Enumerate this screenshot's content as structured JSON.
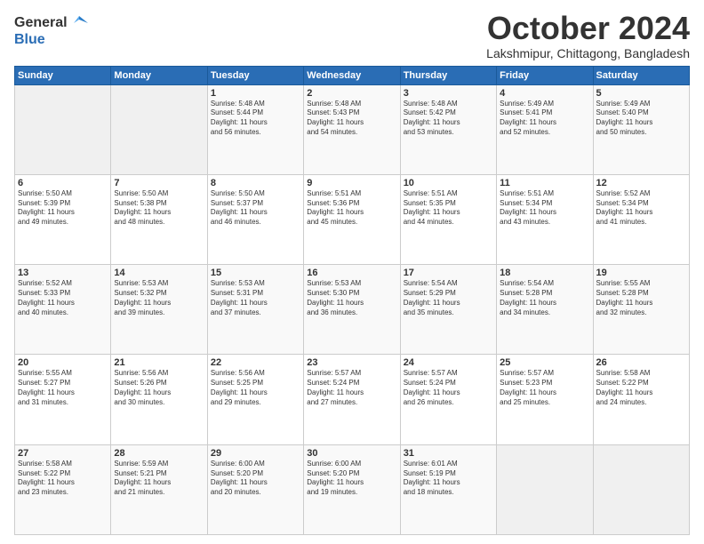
{
  "header": {
    "logo_line1": "General",
    "logo_line2": "Blue",
    "month": "October 2024",
    "location": "Lakshmipur, Chittagong, Bangladesh"
  },
  "weekdays": [
    "Sunday",
    "Monday",
    "Tuesday",
    "Wednesday",
    "Thursday",
    "Friday",
    "Saturday"
  ],
  "weeks": [
    [
      {
        "day": "",
        "info": ""
      },
      {
        "day": "",
        "info": ""
      },
      {
        "day": "1",
        "info": "Sunrise: 5:48 AM\nSunset: 5:44 PM\nDaylight: 11 hours\nand 56 minutes."
      },
      {
        "day": "2",
        "info": "Sunrise: 5:48 AM\nSunset: 5:43 PM\nDaylight: 11 hours\nand 54 minutes."
      },
      {
        "day": "3",
        "info": "Sunrise: 5:48 AM\nSunset: 5:42 PM\nDaylight: 11 hours\nand 53 minutes."
      },
      {
        "day": "4",
        "info": "Sunrise: 5:49 AM\nSunset: 5:41 PM\nDaylight: 11 hours\nand 52 minutes."
      },
      {
        "day": "5",
        "info": "Sunrise: 5:49 AM\nSunset: 5:40 PM\nDaylight: 11 hours\nand 50 minutes."
      }
    ],
    [
      {
        "day": "6",
        "info": "Sunrise: 5:50 AM\nSunset: 5:39 PM\nDaylight: 11 hours\nand 49 minutes."
      },
      {
        "day": "7",
        "info": "Sunrise: 5:50 AM\nSunset: 5:38 PM\nDaylight: 11 hours\nand 48 minutes."
      },
      {
        "day": "8",
        "info": "Sunrise: 5:50 AM\nSunset: 5:37 PM\nDaylight: 11 hours\nand 46 minutes."
      },
      {
        "day": "9",
        "info": "Sunrise: 5:51 AM\nSunset: 5:36 PM\nDaylight: 11 hours\nand 45 minutes."
      },
      {
        "day": "10",
        "info": "Sunrise: 5:51 AM\nSunset: 5:35 PM\nDaylight: 11 hours\nand 44 minutes."
      },
      {
        "day": "11",
        "info": "Sunrise: 5:51 AM\nSunset: 5:34 PM\nDaylight: 11 hours\nand 43 minutes."
      },
      {
        "day": "12",
        "info": "Sunrise: 5:52 AM\nSunset: 5:34 PM\nDaylight: 11 hours\nand 41 minutes."
      }
    ],
    [
      {
        "day": "13",
        "info": "Sunrise: 5:52 AM\nSunset: 5:33 PM\nDaylight: 11 hours\nand 40 minutes."
      },
      {
        "day": "14",
        "info": "Sunrise: 5:53 AM\nSunset: 5:32 PM\nDaylight: 11 hours\nand 39 minutes."
      },
      {
        "day": "15",
        "info": "Sunrise: 5:53 AM\nSunset: 5:31 PM\nDaylight: 11 hours\nand 37 minutes."
      },
      {
        "day": "16",
        "info": "Sunrise: 5:53 AM\nSunset: 5:30 PM\nDaylight: 11 hours\nand 36 minutes."
      },
      {
        "day": "17",
        "info": "Sunrise: 5:54 AM\nSunset: 5:29 PM\nDaylight: 11 hours\nand 35 minutes."
      },
      {
        "day": "18",
        "info": "Sunrise: 5:54 AM\nSunset: 5:28 PM\nDaylight: 11 hours\nand 34 minutes."
      },
      {
        "day": "19",
        "info": "Sunrise: 5:55 AM\nSunset: 5:28 PM\nDaylight: 11 hours\nand 32 minutes."
      }
    ],
    [
      {
        "day": "20",
        "info": "Sunrise: 5:55 AM\nSunset: 5:27 PM\nDaylight: 11 hours\nand 31 minutes."
      },
      {
        "day": "21",
        "info": "Sunrise: 5:56 AM\nSunset: 5:26 PM\nDaylight: 11 hours\nand 30 minutes."
      },
      {
        "day": "22",
        "info": "Sunrise: 5:56 AM\nSunset: 5:25 PM\nDaylight: 11 hours\nand 29 minutes."
      },
      {
        "day": "23",
        "info": "Sunrise: 5:57 AM\nSunset: 5:24 PM\nDaylight: 11 hours\nand 27 minutes."
      },
      {
        "day": "24",
        "info": "Sunrise: 5:57 AM\nSunset: 5:24 PM\nDaylight: 11 hours\nand 26 minutes."
      },
      {
        "day": "25",
        "info": "Sunrise: 5:57 AM\nSunset: 5:23 PM\nDaylight: 11 hours\nand 25 minutes."
      },
      {
        "day": "26",
        "info": "Sunrise: 5:58 AM\nSunset: 5:22 PM\nDaylight: 11 hours\nand 24 minutes."
      }
    ],
    [
      {
        "day": "27",
        "info": "Sunrise: 5:58 AM\nSunset: 5:22 PM\nDaylight: 11 hours\nand 23 minutes."
      },
      {
        "day": "28",
        "info": "Sunrise: 5:59 AM\nSunset: 5:21 PM\nDaylight: 11 hours\nand 21 minutes."
      },
      {
        "day": "29",
        "info": "Sunrise: 6:00 AM\nSunset: 5:20 PM\nDaylight: 11 hours\nand 20 minutes."
      },
      {
        "day": "30",
        "info": "Sunrise: 6:00 AM\nSunset: 5:20 PM\nDaylight: 11 hours\nand 19 minutes."
      },
      {
        "day": "31",
        "info": "Sunrise: 6:01 AM\nSunset: 5:19 PM\nDaylight: 11 hours\nand 18 minutes."
      },
      {
        "day": "",
        "info": ""
      },
      {
        "day": "",
        "info": ""
      }
    ]
  ]
}
